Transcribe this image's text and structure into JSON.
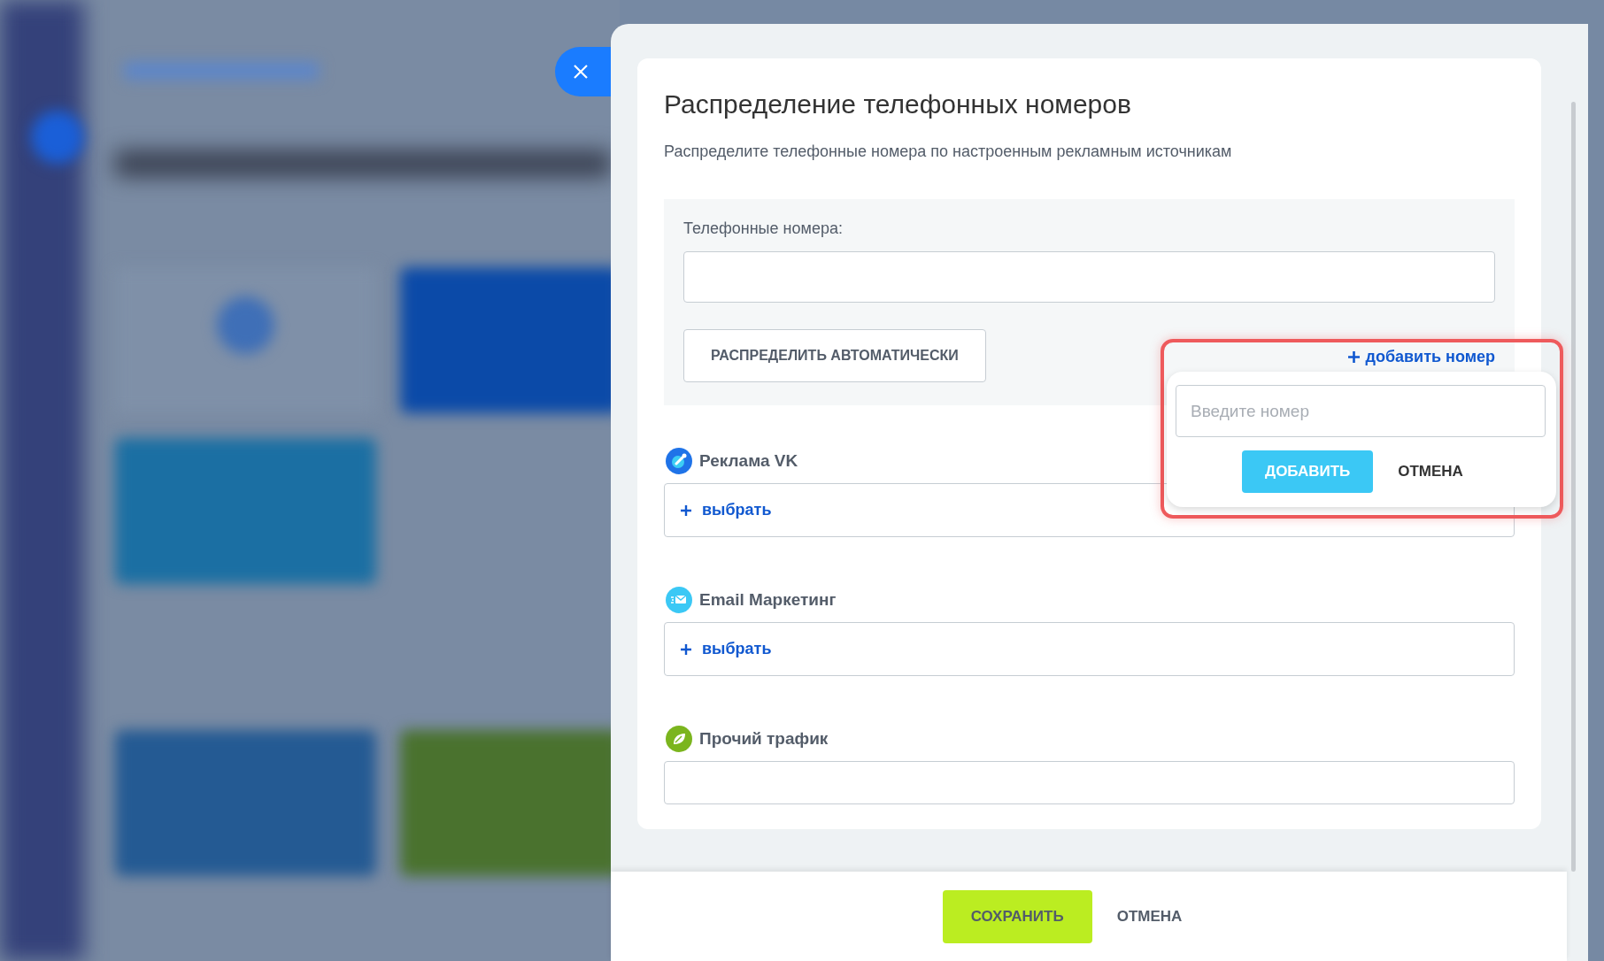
{
  "panel": {
    "title": "Распределение телефонных номеров",
    "subtitle": "Распределите телефонные номера по настроенным рекламным источникам",
    "phones": {
      "label": "Телефонные номера:"
    },
    "auto_button": "РАСПРЕДЕЛИТЬ АВТОМАТИЧЕСКИ",
    "add_number_link": "добавить номер",
    "add_popup": {
      "placeholder": "Введите номер",
      "add_button": "ДОБАВИТЬ",
      "cancel_button": "ОТМЕНА"
    },
    "sources": [
      {
        "kind": "vk",
        "name": "Реклама VK",
        "action": "выбрать"
      },
      {
        "kind": "email",
        "name": "Email Маркетинг",
        "action": "выбрать"
      },
      {
        "kind": "other",
        "name": "Прочий трафик"
      }
    ]
  },
  "footer": {
    "save_button": "СОХРАНИТЬ",
    "cancel_button": "ОТМЕНА"
  }
}
